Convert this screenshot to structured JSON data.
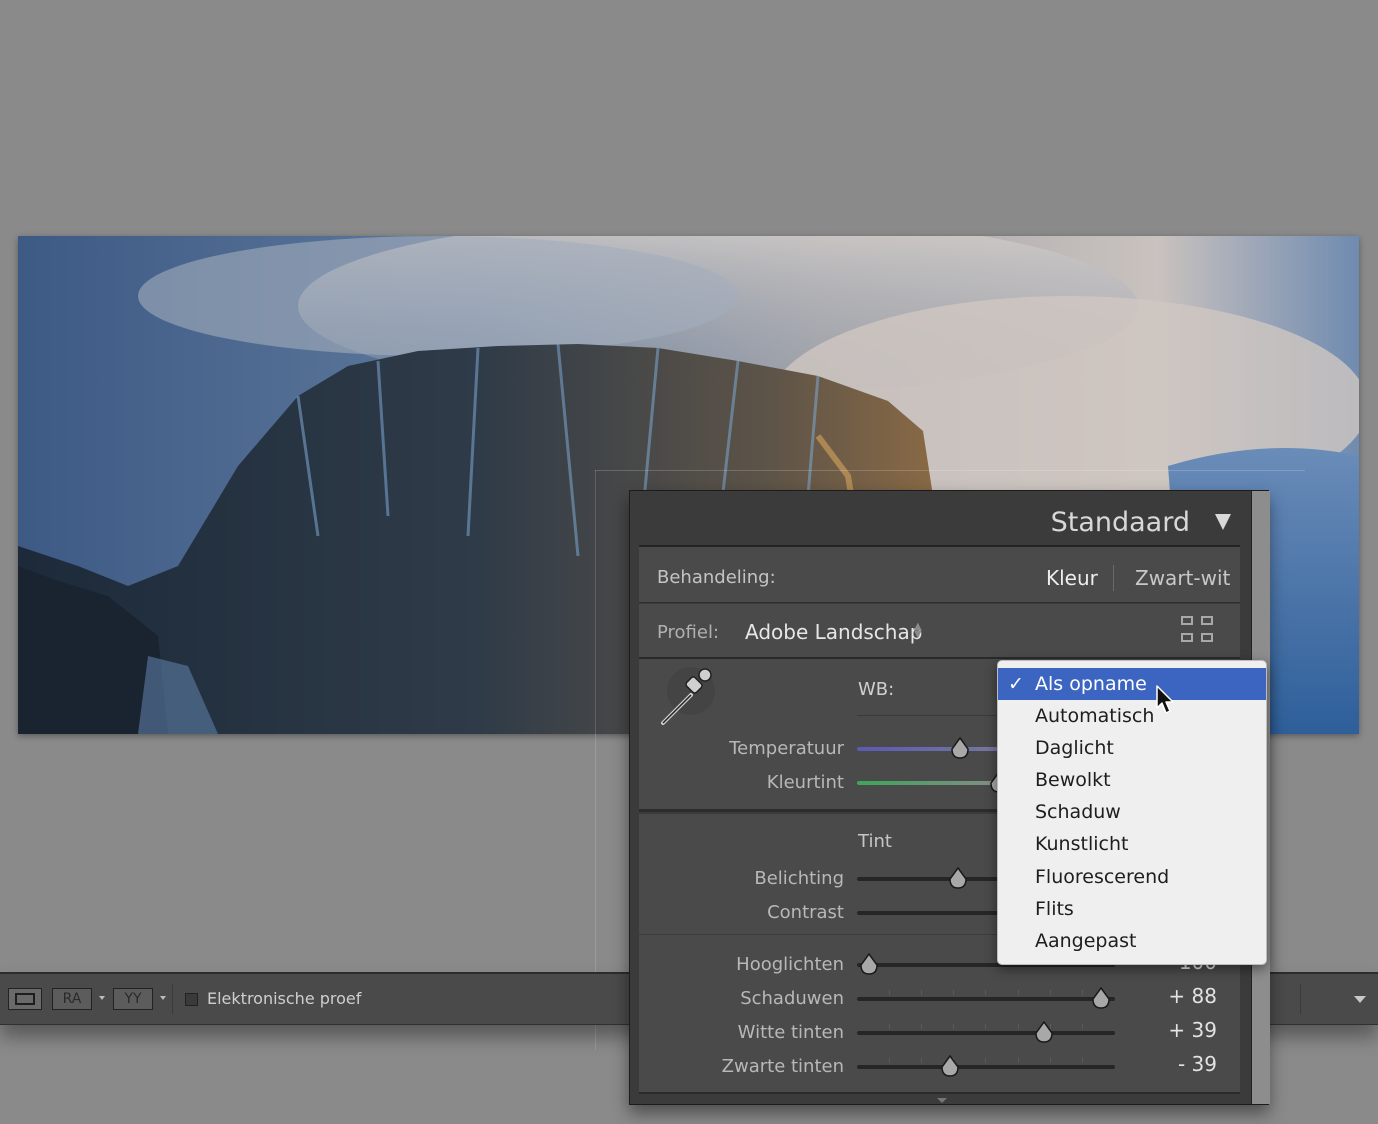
{
  "toolbar": {
    "view_ra": "RA",
    "view_yy": "YY",
    "softproof_label": "Elektronische proef"
  },
  "panel": {
    "title": "Standaard",
    "treatment_label": "Behandeling:",
    "treatment_options": [
      "Kleur",
      "Zwart-wit"
    ],
    "profile_label": "Profiel:",
    "profile_value": "Adobe Landschap",
    "wb_label": "WB:",
    "temperature_label": "Temperatuur",
    "tint_color_label": "Kleurtint",
    "tone_label": "Tint",
    "exposure_label": "Belichting",
    "contrast_label": "Contrast",
    "highlights_label": "Hooglichten",
    "highlights_value": "- 100",
    "shadows_label": "Schaduwen",
    "shadows_value": "+ 88",
    "whites_label": "Witte tinten",
    "whites_value": "+ 39",
    "blacks_label": "Zwarte tinten",
    "blacks_value": "- 39"
  },
  "wb_menu": {
    "check": "✓",
    "selected": "Als opname",
    "items": [
      "Als opname",
      "Automatisch",
      "Daglicht",
      "Bewolkt",
      "Schaduw",
      "Kunstlicht",
      "Fluorescerend",
      "Flits",
      "Aangepast"
    ]
  },
  "colors": {
    "accent": "#3c65c2",
    "temperature_track": "#5a5ab4",
    "tint_track": "#3ca65a"
  },
  "icons": [
    "eyedropper-icon",
    "grid-icon",
    "disclosure-triangle-icon",
    "cursor-icon"
  ]
}
